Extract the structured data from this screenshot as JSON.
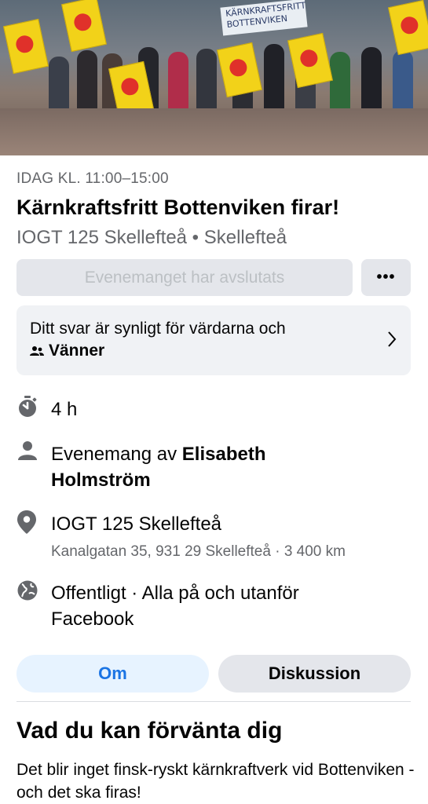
{
  "cover": {
    "banner_text": "KÄRNKRAFTSFRITT BOTTENVIKEN"
  },
  "event": {
    "date_line": "IDAG KL. 11:00–15:00",
    "title": "Kärnkraftsfritt Bottenviken firar!",
    "organizer_line": "IOGT 125 Skellefteå • Skellefteå"
  },
  "actions": {
    "ended_label": "Evenemanget har avslutats",
    "more_label": "•••"
  },
  "visibility": {
    "text": "Ditt svar är synligt för värdarna och",
    "audience": "Vänner"
  },
  "details": {
    "duration": "4 h",
    "hosted_prefix": "Evenemang av ",
    "host_name_line1": "Elisabeth",
    "host_name_line2": "Holmström",
    "venue": "IOGT 125 Skellefteå",
    "address": "Kanalgatan 35, 931 29 Skellefteå · 3 400 km",
    "privacy_line1": "Offentligt · Alla på och utanför",
    "privacy_line2": "Facebook"
  },
  "tabs": [
    {
      "label": "Om",
      "active": true
    },
    {
      "label": "Diskussion",
      "active": false
    }
  ],
  "about": {
    "heading": "Vad du kan förvänta dig",
    "description": "Det blir inget finsk-ryskt kärnkraftverk vid Bottenviken - och det ska firas!"
  },
  "icons": {
    "duration": "stopwatch-icon",
    "host": "person-icon",
    "location": "location-pin-icon",
    "privacy": "globe-icon",
    "audience": "friends-icon",
    "chevron": "chevron-right-icon"
  },
  "colors": {
    "accent": "#1b74e4",
    "accent_bg": "#e7f3ff",
    "secondary_text": "#65676b",
    "button_bg": "#e4e6eb"
  }
}
